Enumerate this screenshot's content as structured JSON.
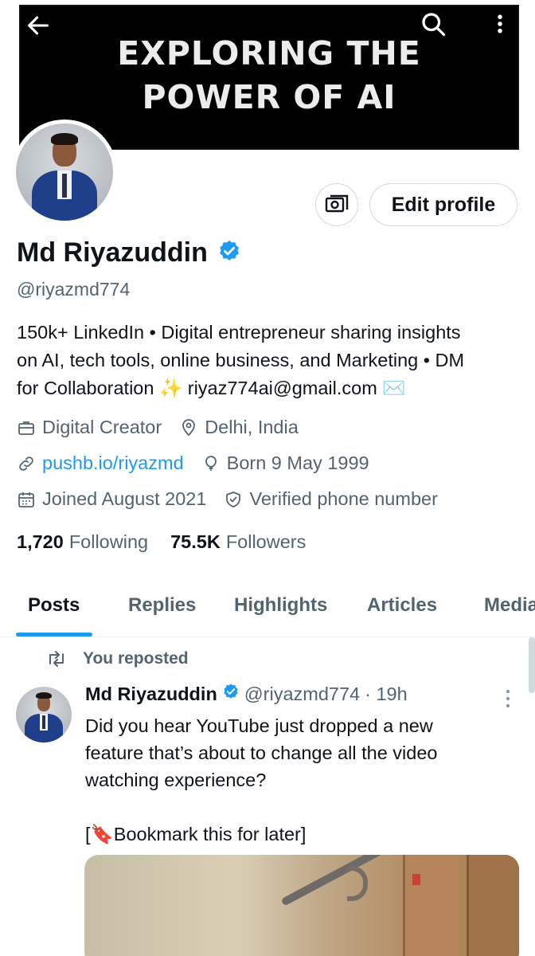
{
  "banner": {
    "line1": "EXPLORING THE",
    "line2": "POWER OF AI"
  },
  "icons": {
    "back": "arrow-left-icon",
    "search": "search-icon",
    "more": "more-vertical-icon",
    "camera": "camera-icon",
    "verified": "verified-badge-icon"
  },
  "profile": {
    "edit_label": "Edit profile",
    "name": "Md Riyazuddin",
    "handle": "@riyazmd774",
    "bio_line1": "150k+ LinkedIn • Digital entrepreneur sharing insights",
    "bio_line2": "on AI, tech tools, online business, and Marketing • DM",
    "bio_line3": "for Collaboration ✨ riyaz774ai@gmail.com ✉️",
    "category": "Digital Creator",
    "location": "Delhi, India",
    "website": "pushb.io/riyazmd",
    "birthday": "Born 9 May 1999",
    "joined": "Joined August 2021",
    "verified_phone": "Verified phone number",
    "following_count": "1,720",
    "following_label": "Following",
    "followers_count": "75.5K",
    "followers_label": "Followers"
  },
  "tabs": [
    {
      "label": "Posts",
      "active": true
    },
    {
      "label": "Replies",
      "active": false
    },
    {
      "label": "Highlights",
      "active": false
    },
    {
      "label": "Articles",
      "active": false
    },
    {
      "label": "Media",
      "active": false
    }
  ],
  "tweet": {
    "repost_label": "You reposted",
    "name": "Md Riyazuddin",
    "handle": "@riyazmd774",
    "time": "· 19h",
    "text_line1": "Did you hear YouTube just dropped a new",
    "text_line2": "feature that’s about to change all the video",
    "text_line3": "watching experience?",
    "bookmark_line": "[🔖Bookmark this for later]"
  },
  "colors": {
    "accent": "#1d9bf0",
    "text_primary": "#0f1419",
    "text_secondary": "#536471"
  }
}
